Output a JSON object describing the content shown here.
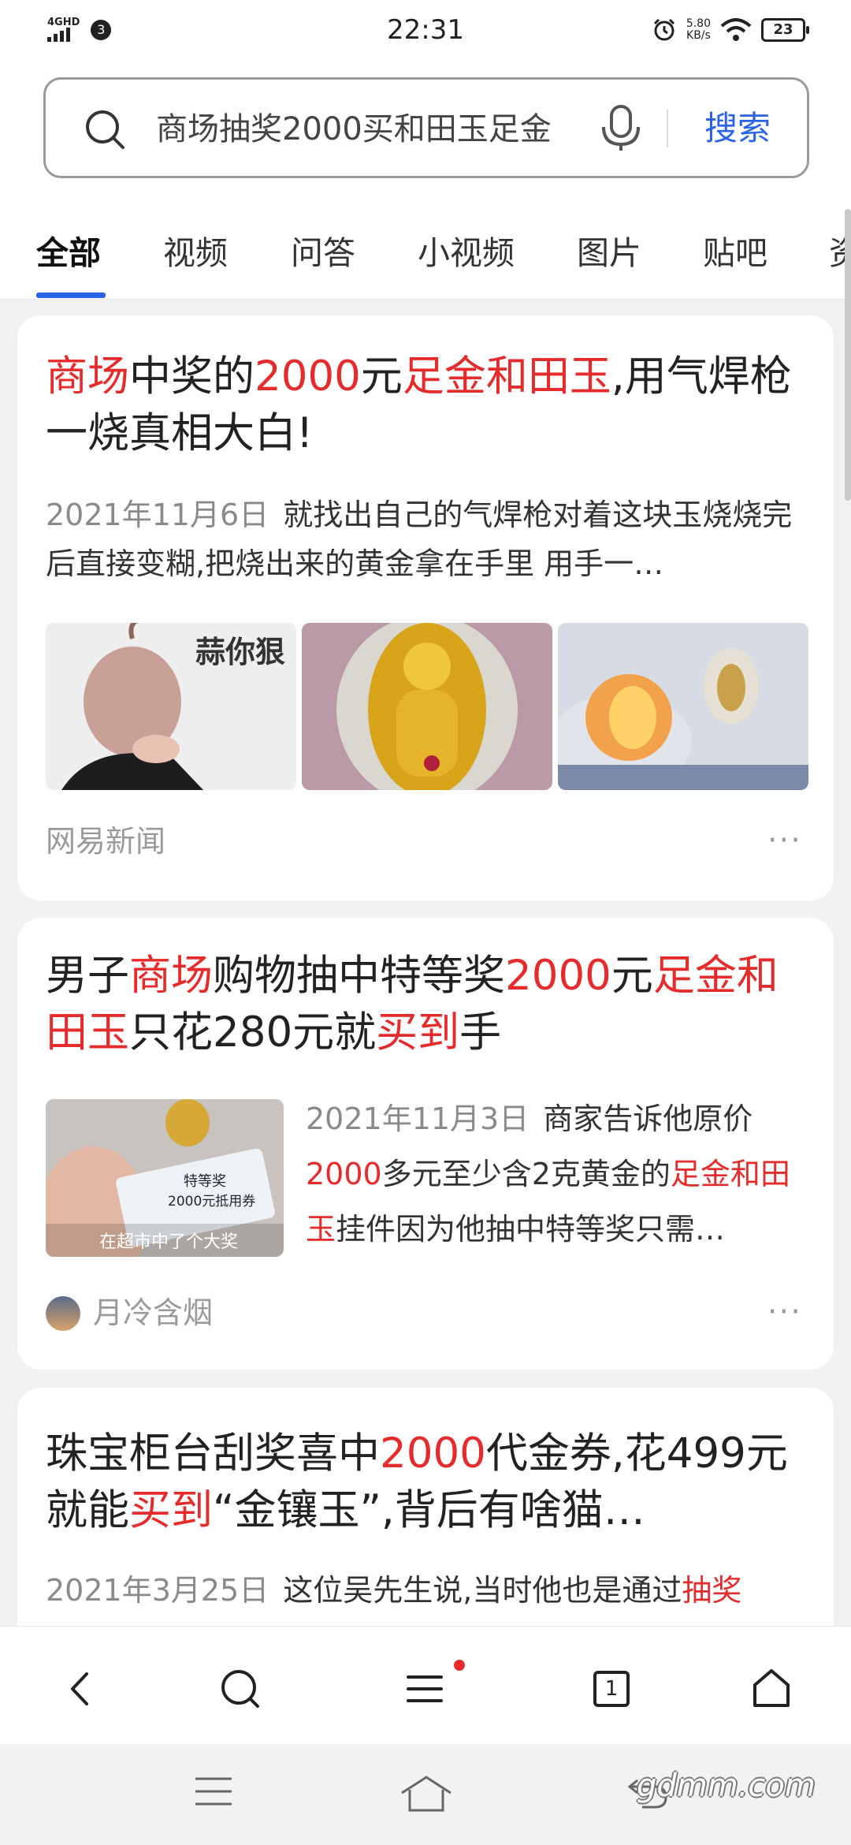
{
  "status_bar": {
    "network": "4GHD",
    "notification_count": "3",
    "time": "22:31",
    "net_speed_value": "5.80",
    "net_speed_unit": "KB/s",
    "battery": "23"
  },
  "search": {
    "query": "商场抽奖2000买和田玉足金",
    "button_label": "搜索"
  },
  "tabs": [
    "全部",
    "视频",
    "问答",
    "小视频",
    "图片",
    "贴吧",
    "资"
  ],
  "results": [
    {
      "title": [
        {
          "text": "商场",
          "hl": true
        },
        {
          "text": "中奖的",
          "hl": false
        },
        {
          "text": "2000",
          "hl": true
        },
        {
          "text": "元",
          "hl": false
        },
        {
          "text": "足金和田玉",
          "hl": true
        },
        {
          "text": ",用气焊枪一烧真相大白!",
          "hl": false
        }
      ],
      "date": "2021年11月6日",
      "snippet": "就找出自己的气焊枪对着这块玉烧烧完后直接变糊,把烧出来的黄金拿在手里 用手一…",
      "image_caption": "蒜你狠",
      "source": "网易新闻",
      "more": "···"
    },
    {
      "title": [
        {
          "text": "男子",
          "hl": false
        },
        {
          "text": "商场",
          "hl": true
        },
        {
          "text": "购物抽中特等奖",
          "hl": false
        },
        {
          "text": "2000",
          "hl": true
        },
        {
          "text": "元",
          "hl": false
        },
        {
          "text": "足金和田玉",
          "hl": true
        },
        {
          "text": "只花280元就",
          "hl": false
        },
        {
          "text": "买到",
          "hl": true
        },
        {
          "text": "手",
          "hl": false
        }
      ],
      "date": "2021年11月3日",
      "snippet": [
        {
          "text": "商家告诉他原价",
          "hl": false
        },
        {
          "text": "2000",
          "hl": true
        },
        {
          "text": "多元至少含2克黄金的",
          "hl": false
        },
        {
          "text": "足金和田玉",
          "hl": true
        },
        {
          "text": "挂件因为他抽中特等奖只需…",
          "hl": false
        }
      ],
      "image_tag_line1": "特等奖",
      "image_tag_line2": "2000元抵用券",
      "image_caption": "在超市中了个大奖",
      "source": "月冷含烟",
      "more": "···"
    },
    {
      "title": [
        {
          "text": "珠宝柜台刮奖喜中",
          "hl": false
        },
        {
          "text": "2000",
          "hl": true
        },
        {
          "text": "代金券,花499元就能",
          "hl": false
        },
        {
          "text": "买到",
          "hl": true
        },
        {
          "text": "“金镶玉”,背后有啥猫…",
          "hl": false
        }
      ],
      "date": "2021年3月25日",
      "snippet": [
        {
          "text": "这位吴先生说,当时他也是通过",
          "hl": false
        },
        {
          "text": "抽奖",
          "hl": true
        }
      ]
    }
  ],
  "bottom_nav": {
    "tab_count": "1"
  },
  "watermark": "gdmm.com",
  "colors": {
    "accent": "#2b63e6",
    "highlight": "#e52b2b"
  }
}
